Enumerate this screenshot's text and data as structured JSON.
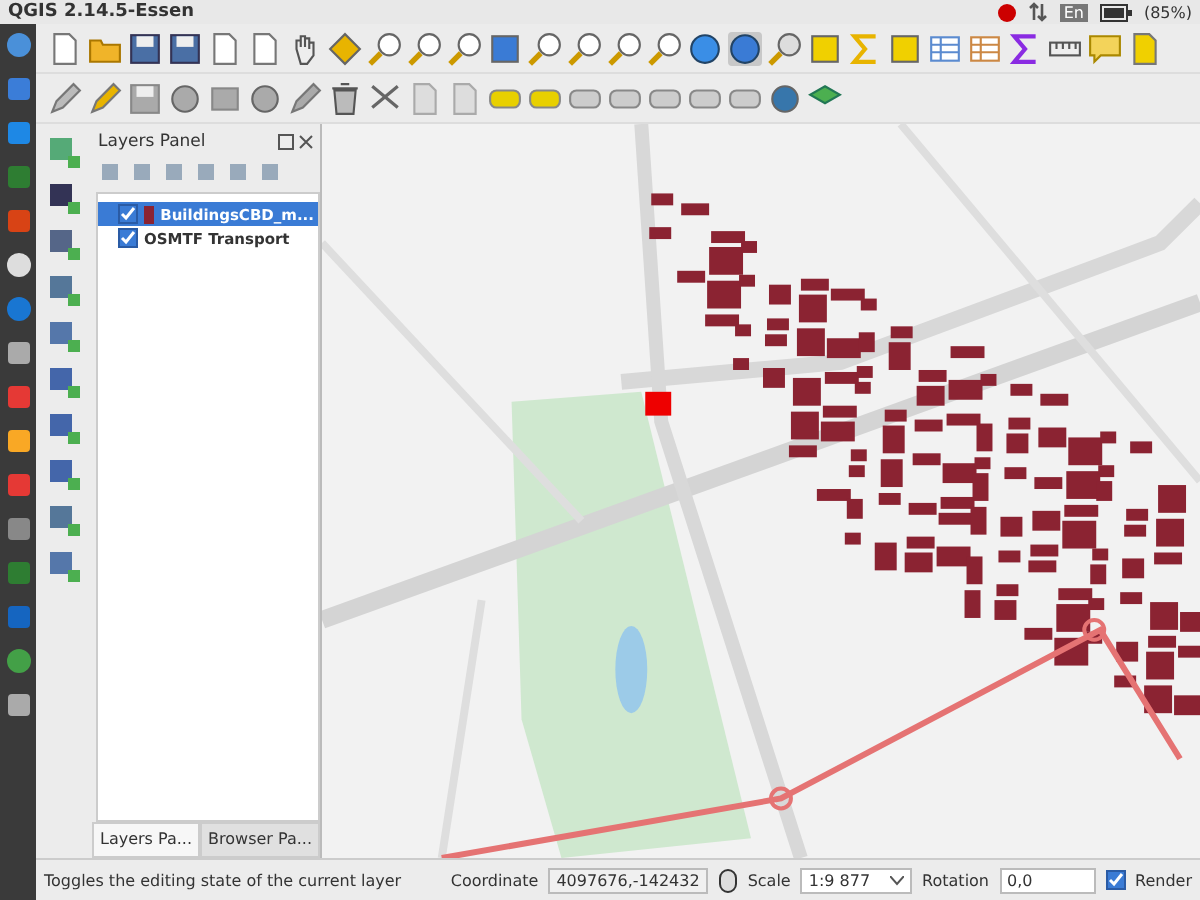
{
  "window": {
    "title": "QGIS 2.14.5-Essen"
  },
  "system_tray": {
    "language": "En",
    "battery": "(85%)"
  },
  "layers_panel": {
    "title": "Layers Panel",
    "layers": [
      {
        "name": "BuildingsCBD_m...",
        "kind": "polygon",
        "checked": true,
        "selected": true
      },
      {
        "name": "OSMTF Transport",
        "kind": "group",
        "checked": true,
        "selected": false
      }
    ],
    "tabs": [
      {
        "label": "Layers Pa...",
        "selected": true
      },
      {
        "label": "Browser Pa...",
        "selected": false
      }
    ]
  },
  "status_bar": {
    "message": "Toggles the editing state of the current layer",
    "coordinate_label": "Coordinate",
    "coordinate": "4097676,-142432",
    "scale_label": "Scale",
    "scale": "1:9 877",
    "rotation_label": "Rotation",
    "rotation": "0,0",
    "render_label": "Render",
    "render_checked": true
  }
}
